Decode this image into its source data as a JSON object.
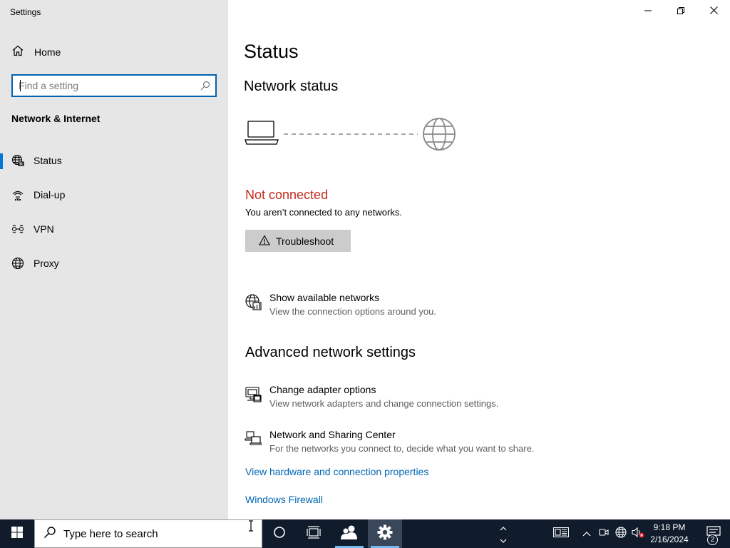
{
  "window": {
    "title": "Settings",
    "controls": [
      "minimize-icon",
      "restore-icon",
      "close-icon"
    ]
  },
  "sidebar": {
    "home_label": "Home",
    "search_placeholder": "Find a setting",
    "section_title": "Network & Internet",
    "items": [
      {
        "label": "Status",
        "icon": "globe-network-icon",
        "active": true
      },
      {
        "label": "Dial-up",
        "icon": "dial-up-icon",
        "active": false
      },
      {
        "label": "VPN",
        "icon": "vpn-icon",
        "active": false
      },
      {
        "label": "Proxy",
        "icon": "globe-icon",
        "active": false
      }
    ]
  },
  "main": {
    "page_title": "Status",
    "network_status_heading": "Network status",
    "connection_status": "Not connected",
    "connection_desc": "You aren’t connected to any networks.",
    "troubleshoot_label": "Troubleshoot",
    "show_networks": {
      "title": "Show available networks",
      "desc": "View the connection options around you."
    },
    "advanced_heading": "Advanced network settings",
    "adapter_options": {
      "title": "Change adapter options",
      "desc": "View network adapters and change connection settings."
    },
    "sharing_center": {
      "title": "Network and Sharing Center",
      "desc": "For the networks you connect to, decide what you want to share."
    },
    "link_hardware": "View hardware and connection properties",
    "link_firewall": "Windows Firewall"
  },
  "taskbar": {
    "search_placeholder": "Type here to search",
    "time": "9:18 PM",
    "date": "2/16/2024",
    "notification_count": "2"
  },
  "colors": {
    "accent": "#0078d7",
    "error": "#c42b1c",
    "link": "#0066b4",
    "sidebar_bg": "#e6e6e6",
    "taskbar_bg": "#101c2c"
  }
}
